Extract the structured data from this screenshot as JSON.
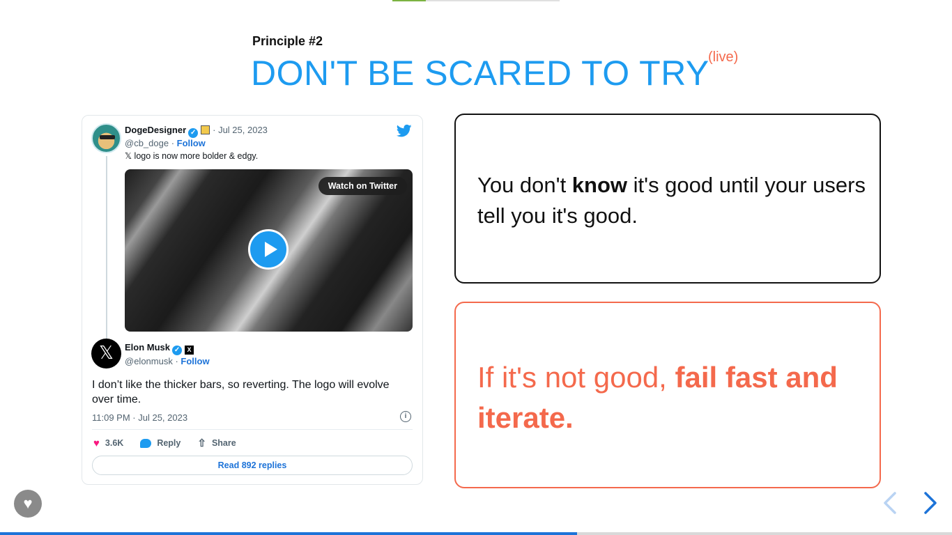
{
  "slide": {
    "eyebrow": "Principle #2",
    "title": "DON'T BE SCARED TO TRY",
    "title_superscript": "(live)",
    "accent_color": "#1d9bf0",
    "highlight_color": "#f4694c"
  },
  "tweet": {
    "quoted": {
      "name": "DogeDesigner",
      "date": "· Jul 25, 2023",
      "handle": "@cb_doge",
      "follow_label": "Follow",
      "text": "𝕏 logo is now more bolder & edgy.",
      "media_button": "Watch on Twitter"
    },
    "main": {
      "name": "Elon Musk",
      "handle": "@elonmusk",
      "follow_label": "Follow",
      "text": "I don’t like the thicker bars, so reverting. The logo will evolve over time.",
      "timestamp": "11:09 PM · Jul 25, 2023"
    },
    "actions": {
      "likes": "3.6K",
      "reply_label": "Reply",
      "share_label": "Share"
    },
    "read_replies": "Read 892 replies"
  },
  "box1": {
    "pre": "You don't ",
    "bold": "know",
    "post": " it's good until your users tell you it's good."
  },
  "box2": {
    "pre": "If it's not good, ",
    "bold": "fail fast and iterate."
  },
  "presentation": {
    "progress_fraction": 0.606
  }
}
